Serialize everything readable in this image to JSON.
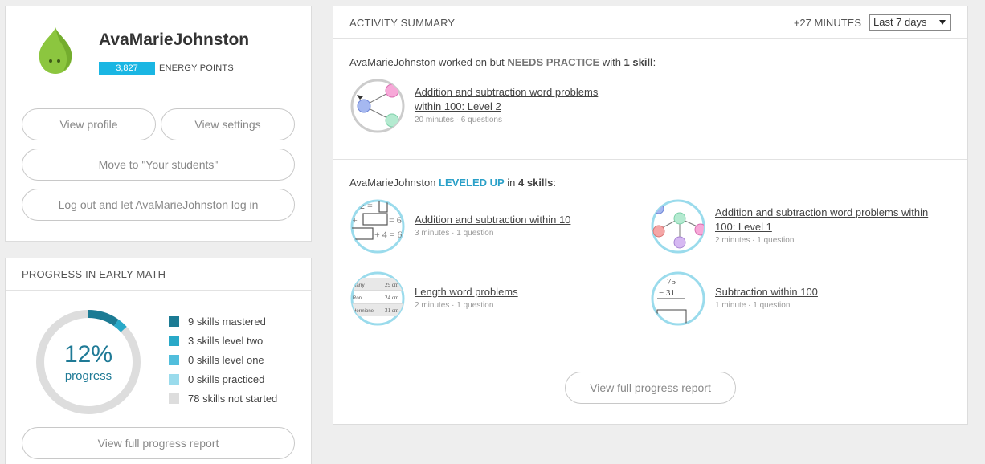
{
  "profile": {
    "username": "AvaMarieJohnston",
    "energy_points": "3,827",
    "energy_label": "ENERGY POINTS",
    "buttons": {
      "view_profile": "View profile",
      "view_settings": "View settings",
      "move_students": "Move to \"Your students\"",
      "logout_login": "Log out and let AvaMarieJohnston log in"
    }
  },
  "progress": {
    "title": "PROGRESS IN EARLY MATH",
    "percent_text": "12%",
    "percent_label": "progress",
    "mastered_fraction": 0.098,
    "level_two_fraction": 0.033,
    "legend": [
      {
        "label": "9 skills mastered",
        "color": "#1c7b94"
      },
      {
        "label": "3 skills level two",
        "color": "#29a9c8"
      },
      {
        "label": "0 skills level one",
        "color": "#51bedc"
      },
      {
        "label": "0 skills practiced",
        "color": "#9adbec"
      },
      {
        "label": "78 skills not started",
        "color": "#dddddd"
      }
    ],
    "report_button": "View full progress report"
  },
  "activity": {
    "title": "ACTIVITY SUMMARY",
    "minutes": "+27 MINUTES",
    "range_selected": "Last 7 days",
    "needs_practice": {
      "pre": "AvaMarieJohnston worked on but ",
      "highlight": "NEEDS PRACTICE",
      "mid": " with ",
      "count": "1 skill",
      "post": ":",
      "skills": [
        {
          "name_line1": "Addition and subtraction word problems",
          "name_line2": "within 100: Level 2",
          "meta": "20 minutes · 6 questions"
        }
      ]
    },
    "leveled_up": {
      "pre": "AvaMarieJohnston ",
      "highlight": "LEVELED UP",
      "mid": " in ",
      "count": "4 skills",
      "post": ":",
      "skills": [
        {
          "name_line1": "Addition and subtraction within 10",
          "name_line2": "",
          "meta": "3 minutes · 1 question"
        },
        {
          "name_line1": "Addition and subtraction word problems within",
          "name_line2": "100: Level 1",
          "meta": "2 minutes · 1 question"
        },
        {
          "name_line1": "Length word problems",
          "name_line2": "",
          "meta": "2 minutes · 1 question"
        },
        {
          "name_line1": "Subtraction within 100",
          "name_line2": "",
          "meta": "1 minute · 1 question"
        }
      ]
    },
    "report_button": "View full progress report"
  },
  "icon_text": {
    "length_rows": [
      {
        "name": "Harry",
        "value": "29 cm"
      },
      {
        "name": "Ron",
        "value": "24 cm"
      },
      {
        "name": "Hermione",
        "value": "31 cm"
      }
    ],
    "sub_top": "75",
    "sub_bottom": "− 31"
  }
}
